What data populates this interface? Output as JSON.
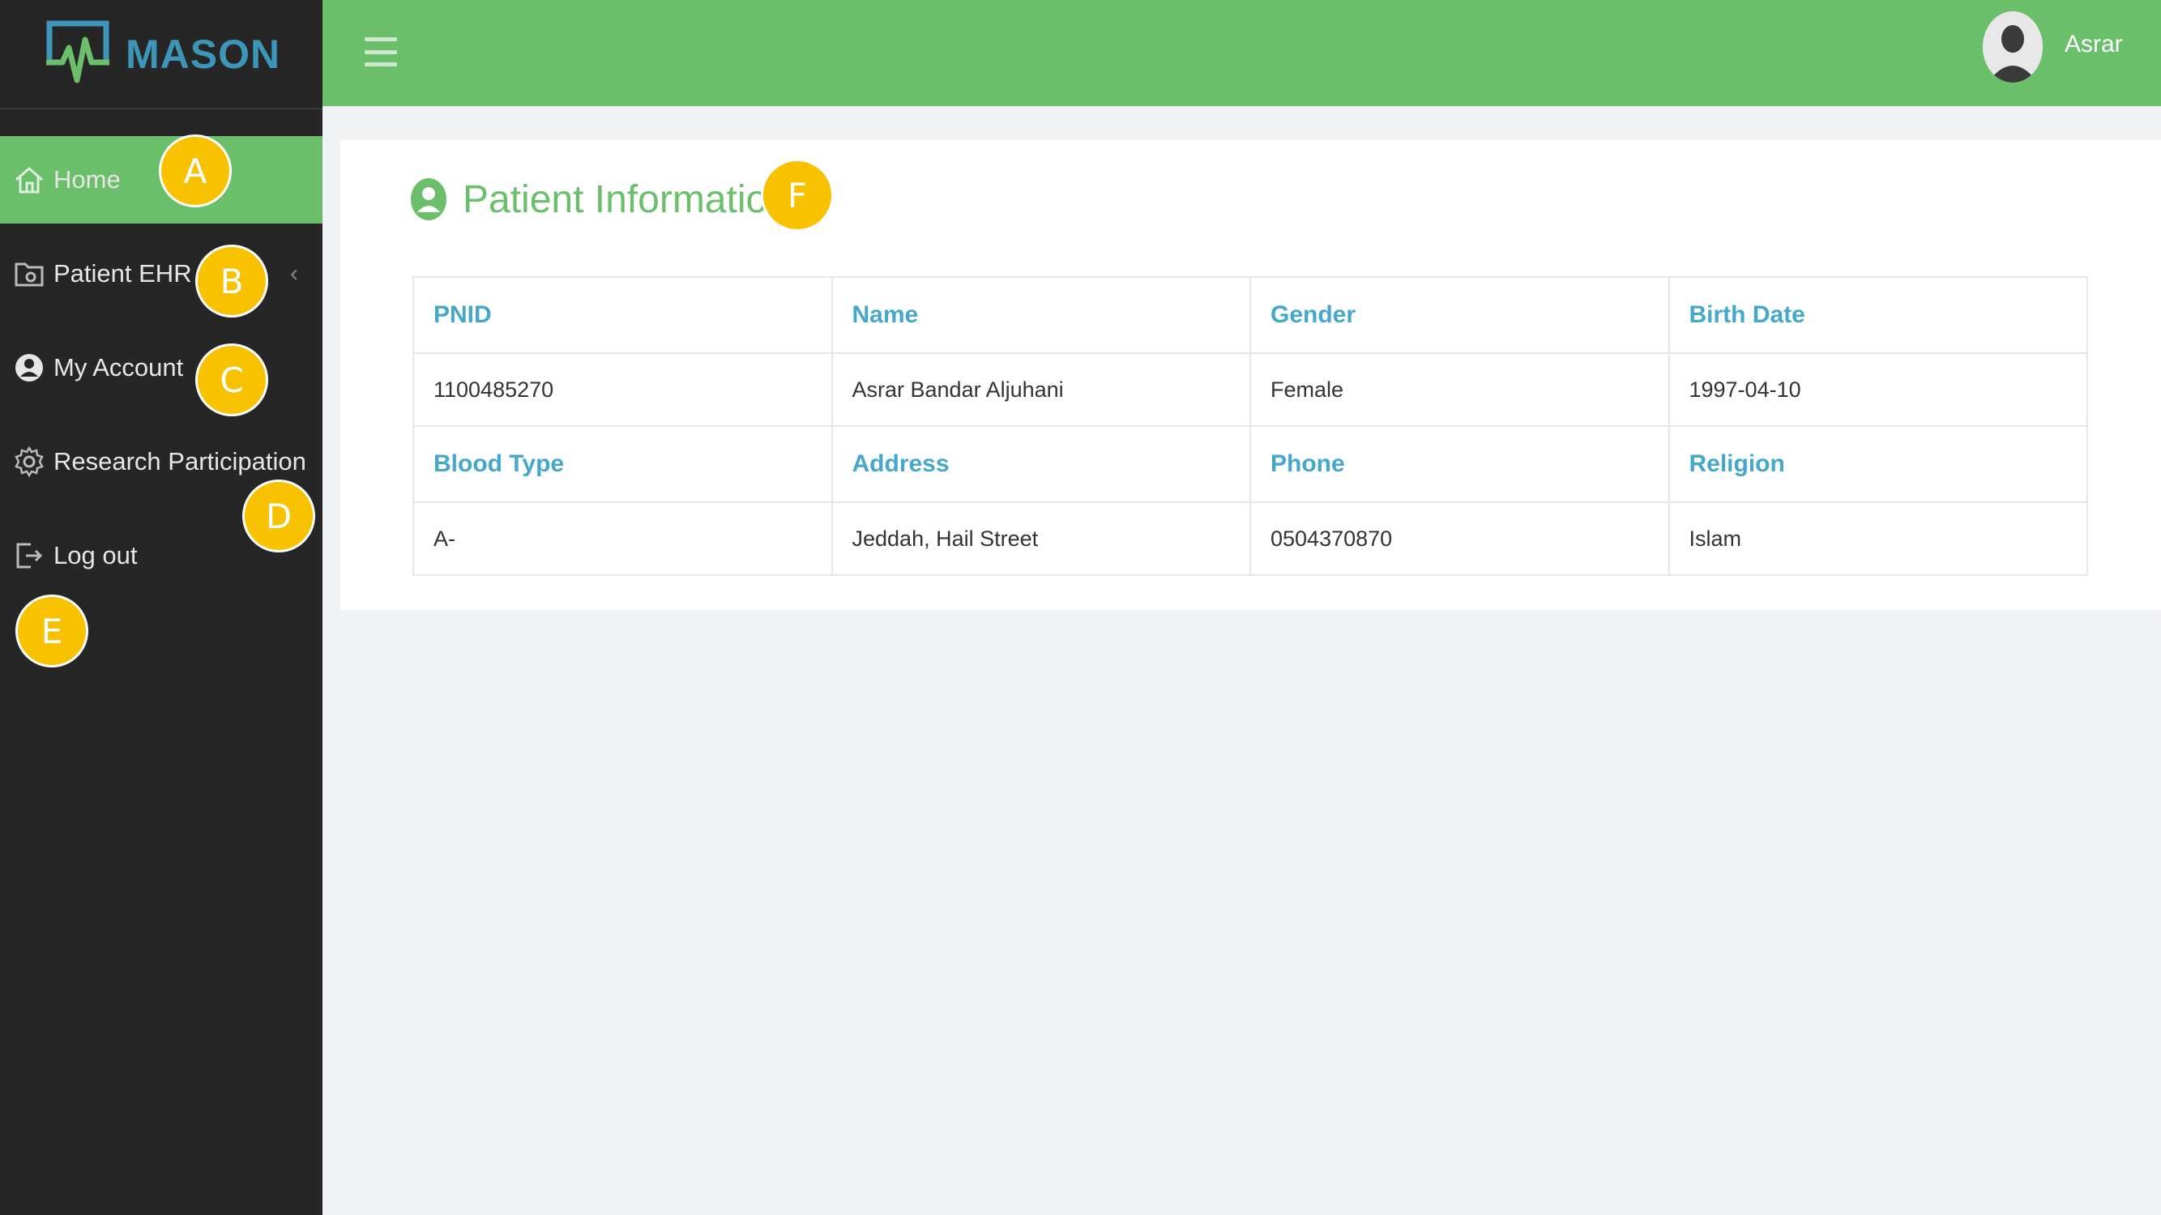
{
  "brand": {
    "name": "MASON",
    "logo_color": "#3d95b8"
  },
  "colors": {
    "accent": "#6bbf6b",
    "sidebar": "#262626",
    "header_text": "#45a7c9",
    "marker": "#f8c200"
  },
  "sidebar": {
    "items": [
      {
        "label": "Home",
        "icon": "home-icon",
        "active": true
      },
      {
        "label": "Patient EHR",
        "icon": "folder-icon",
        "chevron": "‹"
      },
      {
        "label": "My Account",
        "icon": "user-circle-icon"
      },
      {
        "label": "Research Participation",
        "icon": "gear-icon"
      },
      {
        "label": "Log out",
        "icon": "logout-icon"
      }
    ]
  },
  "topbar": {
    "menu_icon": "hamburger-icon",
    "user_name": "Asrar"
  },
  "main": {
    "title": "Patient Information",
    "title_icon": "user-circle-icon",
    "table": {
      "row1_headers": [
        "PNID",
        "Name",
        "Gender",
        "Birth Date"
      ],
      "row1_values": [
        "1100485270",
        "Asrar Bandar Aljuhani",
        "Female",
        "1997-04-10"
      ],
      "row2_headers": [
        "Blood Type",
        "Address",
        "Phone",
        "Religion"
      ],
      "row2_values": [
        "A-",
        "Jeddah, Hail Street",
        "0504370870",
        "Islam"
      ]
    }
  },
  "markers": [
    "A",
    "B",
    "C",
    "D",
    "E",
    "F"
  ]
}
